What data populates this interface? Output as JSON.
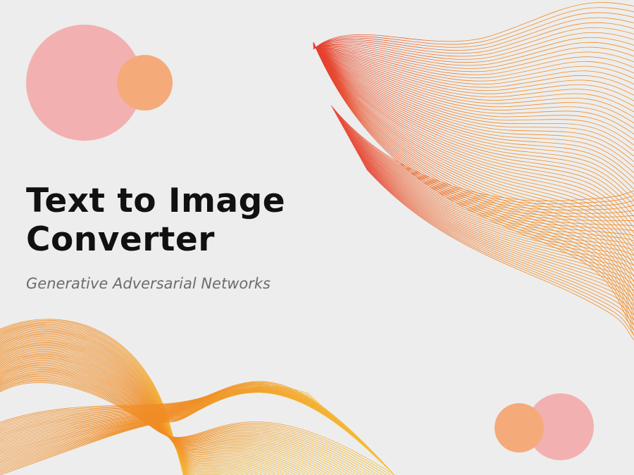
{
  "slide": {
    "title_line1": "Text to Image",
    "title_line2": "Converter",
    "subtitle": "Generative Adversarial Networks"
  },
  "colors": {
    "background": "#ededed",
    "pink": "#f2b1b0",
    "orange": "#f5aa7a",
    "wave_red": "#e63c2e",
    "wave_orange": "#f08c24",
    "wave_yellow": "#f5c034",
    "title": "#111111",
    "subtitle": "#6c6c6c"
  }
}
